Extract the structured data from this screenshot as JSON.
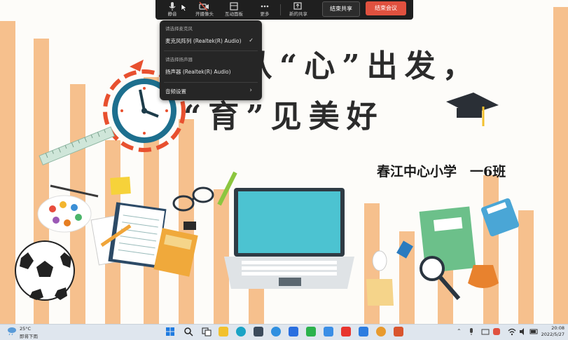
{
  "slide": {
    "title_line1": "从“心”出发，",
    "title_line2": "“育”见美好",
    "school": "春江中心小学　一6班"
  },
  "toolbar": {
    "mute_label": "静音",
    "camera_label": "开摄像头",
    "interact_label": "互动面板",
    "more_label": "更多",
    "new_share_label": "新的共享",
    "end_share_label": "结束共享",
    "end_meeting_label": "结束会议"
  },
  "menu": {
    "mic_header": "请选择麦克风",
    "mic_item": "麦克风阵列 (Realtek(R) Audio)",
    "mic_checked": "✓",
    "speaker_header": "请选择扬声器",
    "speaker_item": "扬声器 (Realtek(R) Audio)",
    "audio_settings": "音频设置",
    "audio_arrow": "›"
  },
  "taskbar": {
    "temp": "25°C",
    "weather": "即将下雨",
    "time": "20:08",
    "date": "2022/5/27",
    "icons": [
      "windows-icon",
      "search-icon",
      "task-view-icon",
      "file-explorer-icon",
      "edge-icon",
      "store-icon",
      "ie-icon",
      "app-icon",
      "wechat-icon",
      "video-icon",
      "wps-icon",
      "media-icon",
      "chrome-icon",
      "presentation-icon"
    ]
  },
  "colors": {
    "stripe": "#f6c08d",
    "toolbar_bg": "#1f1f1f",
    "end_button": "#e0513f",
    "menu_bg": "#262626",
    "taskbar_bg": "#dfe6ee"
  }
}
